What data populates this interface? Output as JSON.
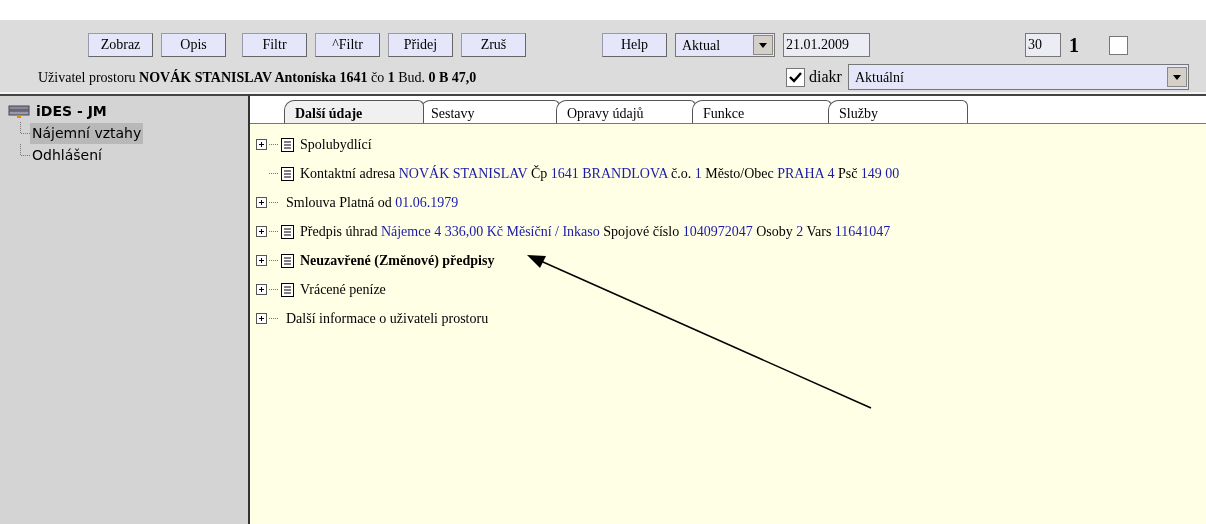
{
  "toolbar": {
    "buttons": [
      {
        "label": "Zobraz"
      },
      {
        "label": "Opis"
      },
      {
        "label": "Filtr"
      },
      {
        "label": "^Filtr"
      },
      {
        "label": "Přidej"
      },
      {
        "label": "Zruš"
      },
      {
        "label": "Help"
      }
    ],
    "mode_select": {
      "value": "Aktual"
    },
    "date_field": {
      "value": "21.01.2009"
    },
    "count_field": {
      "value": "30"
    },
    "page_label": "1",
    "extra_checkbox": {
      "checked": false
    },
    "user_info": "Uživatel prostoru **NOVÁK STANISLAV Antoníska 1641** čo **1** Bud. **0 B 47,0**",
    "diakr_checkbox": {
      "label": "diakr",
      "checked": true
    },
    "state_select": {
      "value": "Aktuální"
    }
  },
  "sidebar": {
    "items": [
      {
        "label": "iDES - JM",
        "selected": false,
        "children": [
          {
            "label": "Nájemní vztahy",
            "selected": true
          },
          {
            "label": "Odhlášení",
            "selected": false
          }
        ]
      }
    ]
  },
  "tabs": [
    {
      "label": "Další údaje",
      "selected": true
    },
    {
      "label": "Sestavy",
      "selected": false
    },
    {
      "label": "Opravy údajů",
      "selected": false
    },
    {
      "label": "Funkce",
      "selected": false
    },
    {
      "label": "Služby",
      "selected": false
    }
  ],
  "rows": [
    {
      "expandable": true,
      "document_icon": true,
      "emphasized": false,
      "parts": [
        {
          "kind": "label",
          "text": "Spolubydlící"
        }
      ]
    },
    {
      "expandable": false,
      "document_icon": true,
      "emphasized": false,
      "parts": [
        {
          "kind": "label",
          "text": "Kontaktní adresa"
        },
        {
          "kind": "value",
          "text": "NOVÁK STANISLAV"
        },
        {
          "kind": "label",
          "text": "Čp"
        },
        {
          "kind": "value",
          "text": "1641 BRANDLOVA"
        },
        {
          "kind": "label",
          "text": "č.o."
        },
        {
          "kind": "value",
          "text": "1"
        },
        {
          "kind": "label",
          "text": "Město/Obec"
        },
        {
          "kind": "value",
          "text": "PRAHA 4"
        },
        {
          "kind": "label",
          "text": "Psč"
        },
        {
          "kind": "value",
          "text": "149 00"
        }
      ]
    },
    {
      "expandable": true,
      "document_icon": false,
      "emphasized": false,
      "parts": [
        {
          "kind": "label",
          "text": "Smlouva Platná od"
        },
        {
          "kind": "value",
          "text": "01.06.1979"
        }
      ]
    },
    {
      "expandable": true,
      "document_icon": true,
      "emphasized": false,
      "parts": [
        {
          "kind": "label",
          "text": "Předpis úhrad"
        },
        {
          "kind": "value",
          "text": "Nájemce 4 336,00 Kč"
        },
        {
          "kind": "value",
          "text": "Měsíční / Inkaso"
        },
        {
          "kind": "label",
          "text": "Spojové číslo"
        },
        {
          "kind": "value",
          "text": "1040972047"
        },
        {
          "kind": "label",
          "text": "Osoby"
        },
        {
          "kind": "value",
          "text": "2"
        },
        {
          "kind": "label",
          "text": "Vars"
        },
        {
          "kind": "value",
          "text": "11641047"
        }
      ]
    },
    {
      "expandable": true,
      "document_icon": true,
      "emphasized": true,
      "parts": [
        {
          "kind": "label",
          "text": "Neuzavřené (Změnové) předpisy"
        }
      ]
    },
    {
      "expandable": true,
      "document_icon": true,
      "emphasized": false,
      "parts": [
        {
          "kind": "label",
          "text": "Vrácené peníze"
        }
      ]
    },
    {
      "expandable": true,
      "document_icon": false,
      "emphasized": false,
      "parts": [
        {
          "kind": "label",
          "text": "Další informace o uživateli prostoru"
        }
      ]
    }
  ]
}
